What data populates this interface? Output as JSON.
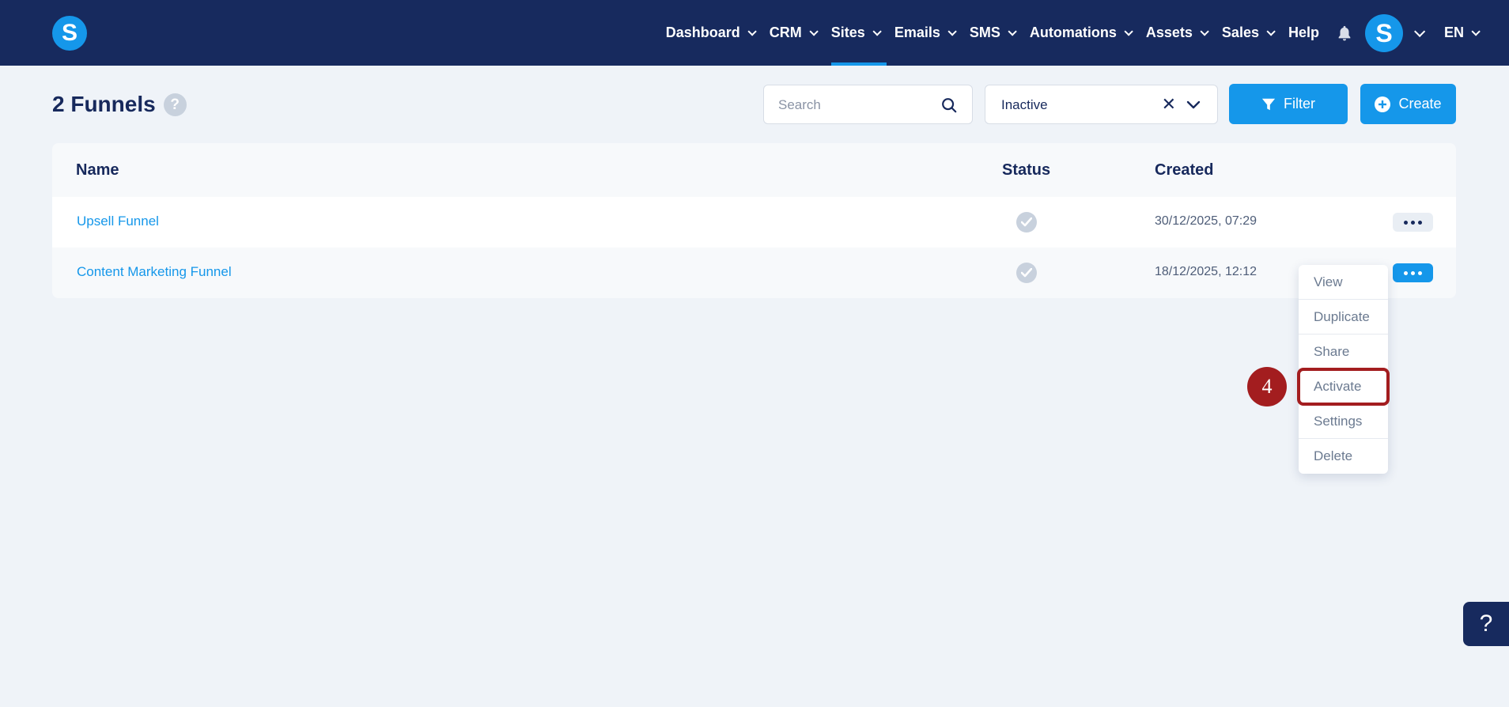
{
  "app": {
    "logo_letter": "S"
  },
  "nav": {
    "items": [
      {
        "label": "Dashboard",
        "has_dropdown": true
      },
      {
        "label": "CRM",
        "has_dropdown": true
      },
      {
        "label": "Sites",
        "has_dropdown": true,
        "active": true
      },
      {
        "label": "Emails",
        "has_dropdown": true
      },
      {
        "label": "SMS",
        "has_dropdown": true
      },
      {
        "label": "Automations",
        "has_dropdown": true
      },
      {
        "label": "Assets",
        "has_dropdown": true
      },
      {
        "label": "Sales",
        "has_dropdown": true
      },
      {
        "label": "Help",
        "has_dropdown": false
      }
    ],
    "avatar_letter": "S",
    "language": "EN"
  },
  "page": {
    "title": "2 Funnels",
    "help_glyph": "?",
    "search": {
      "placeholder": "Search",
      "value": ""
    },
    "status_filter": {
      "value": "Inactive",
      "clear_glyph": "✕"
    },
    "filter_label": "Filter",
    "create_label": "Create"
  },
  "table": {
    "headers": {
      "name": "Name",
      "status": "Status",
      "created": "Created"
    },
    "rows": [
      {
        "name": "Upsell Funnel",
        "created": "30/12/2025, 07:29"
      },
      {
        "name": "Content Marketing Funnel",
        "created": "18/12/2025, 12:12"
      }
    ]
  },
  "row_menu": {
    "items": [
      "View",
      "Duplicate",
      "Share",
      "Activate",
      "Settings",
      "Delete"
    ],
    "highlighted": "Activate"
  },
  "annotation": {
    "step": "4"
  },
  "help_fab": "?",
  "colors": {
    "nav_bg": "#172a5e",
    "accent": "#1597ea",
    "page_bg": "#eff3f8",
    "highlight": "#a31d1f"
  }
}
